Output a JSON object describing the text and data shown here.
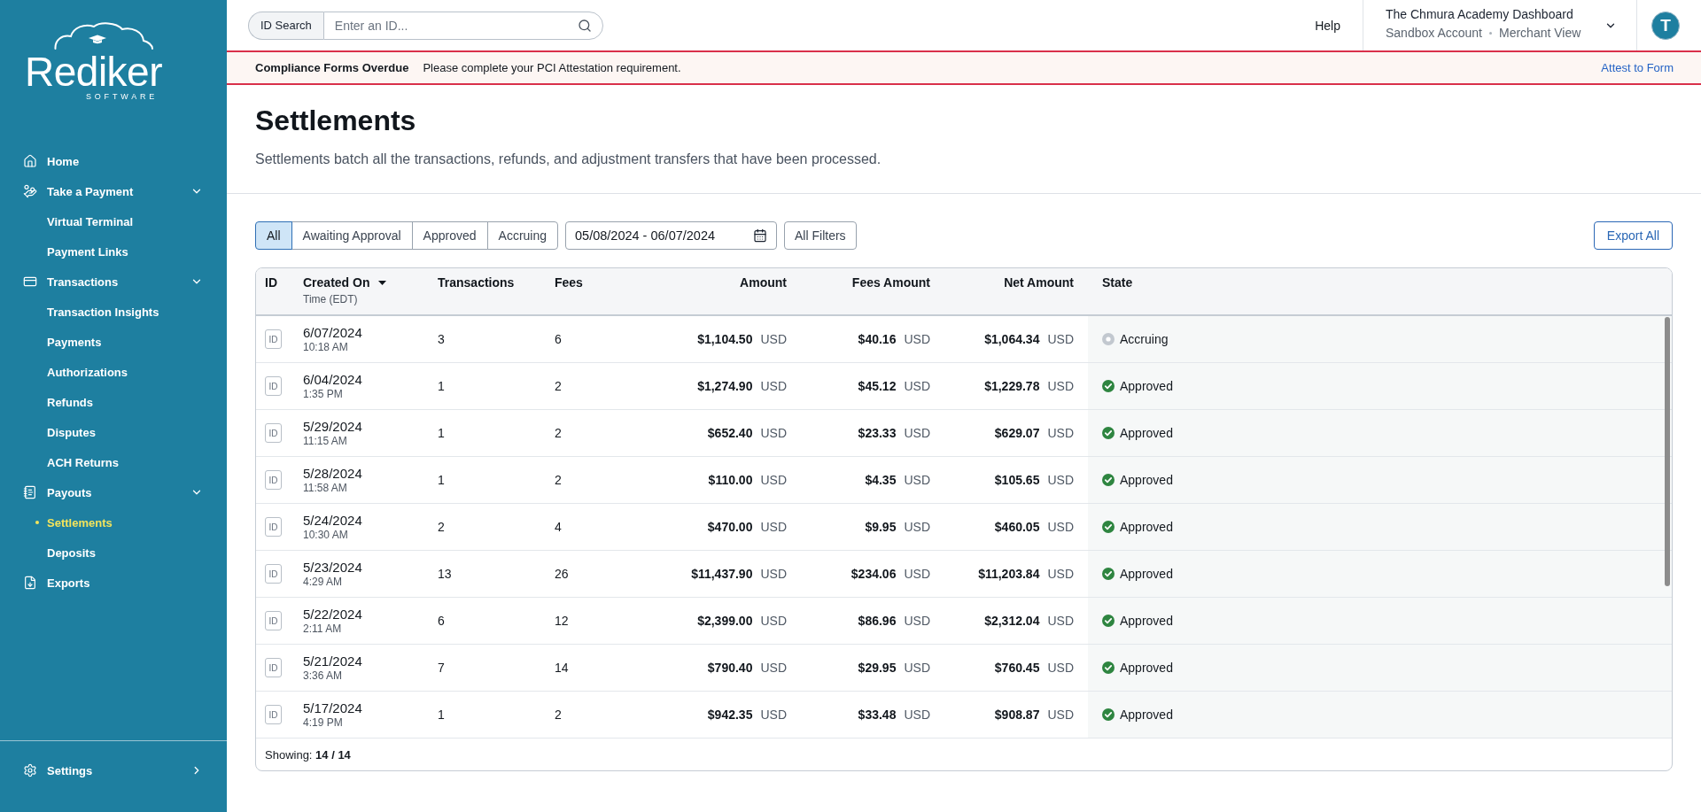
{
  "sidebar": {
    "logo": {
      "name": "Rediker",
      "tagline": "SOFTWARE"
    },
    "items": [
      {
        "label": "Home",
        "selected": false
      },
      {
        "label": "Take a Payment",
        "selected": false,
        "expanded": true,
        "children": [
          {
            "label": "Virtual Terminal",
            "selected": false
          },
          {
            "label": "Payment Links",
            "selected": false
          }
        ]
      },
      {
        "label": "Transactions",
        "selected": false,
        "expanded": true,
        "children": [
          {
            "label": "Transaction Insights",
            "selected": false
          },
          {
            "label": "Payments",
            "selected": false
          },
          {
            "label": "Authorizations",
            "selected": false
          },
          {
            "label": "Refunds",
            "selected": false
          },
          {
            "label": "Disputes",
            "selected": false
          },
          {
            "label": "ACH Returns",
            "selected": false
          }
        ]
      },
      {
        "label": "Payouts",
        "selected": false,
        "expanded": true,
        "children": [
          {
            "label": "Settlements",
            "selected": true
          },
          {
            "label": "Deposits",
            "selected": false
          }
        ]
      },
      {
        "label": "Exports",
        "selected": false
      }
    ],
    "settings": {
      "label": "Settings",
      "selected": false,
      "expanded": false
    }
  },
  "top_bar": {
    "id_search": {
      "label": "ID Search",
      "placeholder": "Enter an ID..."
    },
    "help": "Help",
    "account": {
      "name": "The Chmura Academy Dashboard",
      "details": [
        "Sandbox Account",
        "Merchant View"
      ]
    },
    "avatar": "T"
  },
  "banner": {
    "title": "Compliance Forms Overdue",
    "message": "Please complete your PCI Attestation requirement.",
    "link": "Attest to Form"
  },
  "page": {
    "title": "Settlements",
    "description": "Settlements batch all the transactions, refunds, and adjustment transfers that have been processed."
  },
  "filters": {
    "tabs": [
      {
        "label": "All",
        "selected": true
      },
      {
        "label": "Awaiting Approval",
        "selected": false
      },
      {
        "label": "Approved",
        "selected": false
      },
      {
        "label": "Accruing",
        "selected": false
      }
    ],
    "date_range": "05/08/2024 - 06/07/2024",
    "all_filters": "All Filters",
    "export": "Export All"
  },
  "table": {
    "columns": [
      {
        "label": "ID",
        "sorted": false
      },
      {
        "label": "Created On",
        "sublabel": "Time (EDT)",
        "sorted": true
      },
      {
        "label": "Transactions",
        "sorted": false
      },
      {
        "label": "Fees",
        "sorted": false
      },
      {
        "label": "Amount",
        "sorted": false
      },
      {
        "label": "Fees Amount",
        "sorted": false
      },
      {
        "label": "Net Amount",
        "sorted": false
      },
      {
        "label": "State",
        "sorted": false
      }
    ],
    "rows": [
      {
        "id_badge": "ID",
        "date": "6/07/2024",
        "time": "10:18 AM",
        "transactions": "3",
        "fees": "6",
        "amount": "$1,104.50",
        "amount_currency": "USD",
        "fees_amount": "$40.16",
        "fees_amount_currency": "USD",
        "net_amount": "$1,064.34",
        "net_amount_currency": "USD",
        "state": {
          "kind": "accruing",
          "label": "Accruing"
        }
      },
      {
        "id_badge": "ID",
        "date": "6/04/2024",
        "time": "1:35 PM",
        "transactions": "1",
        "fees": "2",
        "amount": "$1,274.90",
        "amount_currency": "USD",
        "fees_amount": "$45.12",
        "fees_amount_currency": "USD",
        "net_amount": "$1,229.78",
        "net_amount_currency": "USD",
        "state": {
          "kind": "approved",
          "label": "Approved"
        }
      },
      {
        "id_badge": "ID",
        "date": "5/29/2024",
        "time": "11:15 AM",
        "transactions": "1",
        "fees": "2",
        "amount": "$652.40",
        "amount_currency": "USD",
        "fees_amount": "$23.33",
        "fees_amount_currency": "USD",
        "net_amount": "$629.07",
        "net_amount_currency": "USD",
        "state": {
          "kind": "approved",
          "label": "Approved"
        }
      },
      {
        "id_badge": "ID",
        "date": "5/28/2024",
        "time": "11:58 AM",
        "transactions": "1",
        "fees": "2",
        "amount": "$110.00",
        "amount_currency": "USD",
        "fees_amount": "$4.35",
        "fees_amount_currency": "USD",
        "net_amount": "$105.65",
        "net_amount_currency": "USD",
        "state": {
          "kind": "approved",
          "label": "Approved"
        }
      },
      {
        "id_badge": "ID",
        "date": "5/24/2024",
        "time": "10:30 AM",
        "transactions": "2",
        "fees": "4",
        "amount": "$470.00",
        "amount_currency": "USD",
        "fees_amount": "$9.95",
        "fees_amount_currency": "USD",
        "net_amount": "$460.05",
        "net_amount_currency": "USD",
        "state": {
          "kind": "approved",
          "label": "Approved"
        }
      },
      {
        "id_badge": "ID",
        "date": "5/23/2024",
        "time": "4:29 AM",
        "transactions": "13",
        "fees": "26",
        "amount": "$11,437.90",
        "amount_currency": "USD",
        "fees_amount": "$234.06",
        "fees_amount_currency": "USD",
        "net_amount": "$11,203.84",
        "net_amount_currency": "USD",
        "state": {
          "kind": "approved",
          "label": "Approved"
        }
      },
      {
        "id_badge": "ID",
        "date": "5/22/2024",
        "time": "2:11 AM",
        "transactions": "6",
        "fees": "12",
        "amount": "$2,399.00",
        "amount_currency": "USD",
        "fees_amount": "$86.96",
        "fees_amount_currency": "USD",
        "net_amount": "$2,312.04",
        "net_amount_currency": "USD",
        "state": {
          "kind": "approved",
          "label": "Approved"
        }
      },
      {
        "id_badge": "ID",
        "date": "5/21/2024",
        "time": "3:36 AM",
        "transactions": "7",
        "fees": "14",
        "amount": "$790.40",
        "amount_currency": "USD",
        "fees_amount": "$29.95",
        "fees_amount_currency": "USD",
        "net_amount": "$760.45",
        "net_amount_currency": "USD",
        "state": {
          "kind": "approved",
          "label": "Approved"
        }
      },
      {
        "id_badge": "ID",
        "date": "5/17/2024",
        "time": "4:19 PM",
        "transactions": "1",
        "fees": "2",
        "amount": "$942.35",
        "amount_currency": "USD",
        "fees_amount": "$33.48",
        "fees_amount_currency": "USD",
        "net_amount": "$908.87",
        "net_amount_currency": "USD",
        "state": {
          "kind": "approved",
          "label": "Approved"
        }
      }
    ],
    "footer": "Showing: **14 / 14**"
  }
}
